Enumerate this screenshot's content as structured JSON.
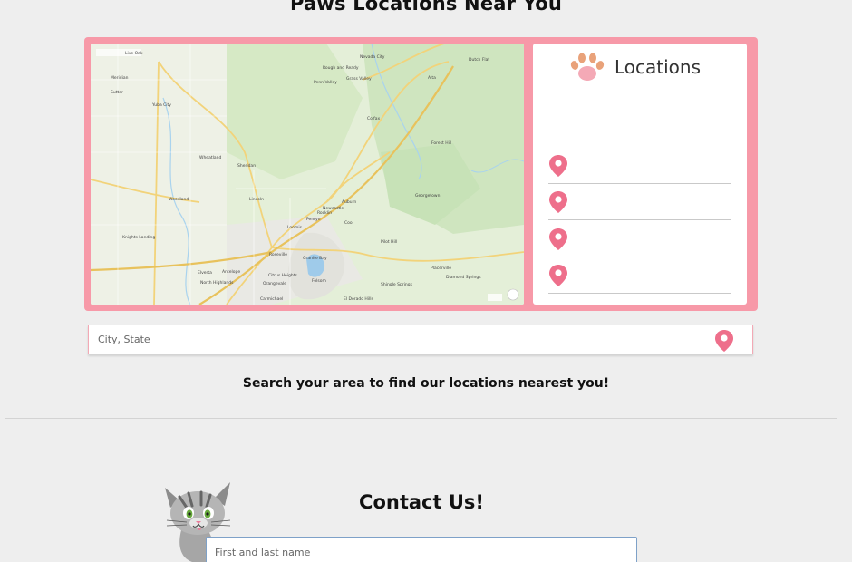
{
  "page": {
    "title": "Paws Locations Near You",
    "search_hint": "Search your area to find our locations nearest you!"
  },
  "locations": {
    "title": "Locations",
    "items": [
      "",
      "",
      "",
      ""
    ]
  },
  "search": {
    "placeholder": "City, State"
  },
  "contact": {
    "title": "Contact Us!",
    "name_placeholder": "First and last name"
  },
  "map": {
    "labels": [
      "Yuba City",
      "Sutter",
      "Live Oak",
      "Meridian",
      "Sheridan",
      "Lincoln",
      "Rocklin",
      "Roseville",
      "Citrus Heights",
      "Folsom",
      "Auburn",
      "Colfax",
      "Grass Valley",
      "Nevada City",
      "Antelope",
      "North Highlands",
      "Carmichael",
      "Orangevale",
      "Granite Bay",
      "Loomis",
      "Penryn",
      "Newcastle",
      "Placerville",
      "Shingle Springs",
      "El Dorado Hills",
      "Georgetown",
      "Cool",
      "Pilot Hill",
      "Knights Landing",
      "Woodland",
      "Wheatland",
      "Elverta",
      "Diamond Springs",
      "Rough and Ready",
      "Penn Valley",
      "Alta",
      "Dutch Flat",
      "Forest Hill"
    ]
  },
  "colors": {
    "accent_pink": "#f799a8",
    "pin_pink": "#ee6f8b",
    "background": "#eeeeee"
  }
}
